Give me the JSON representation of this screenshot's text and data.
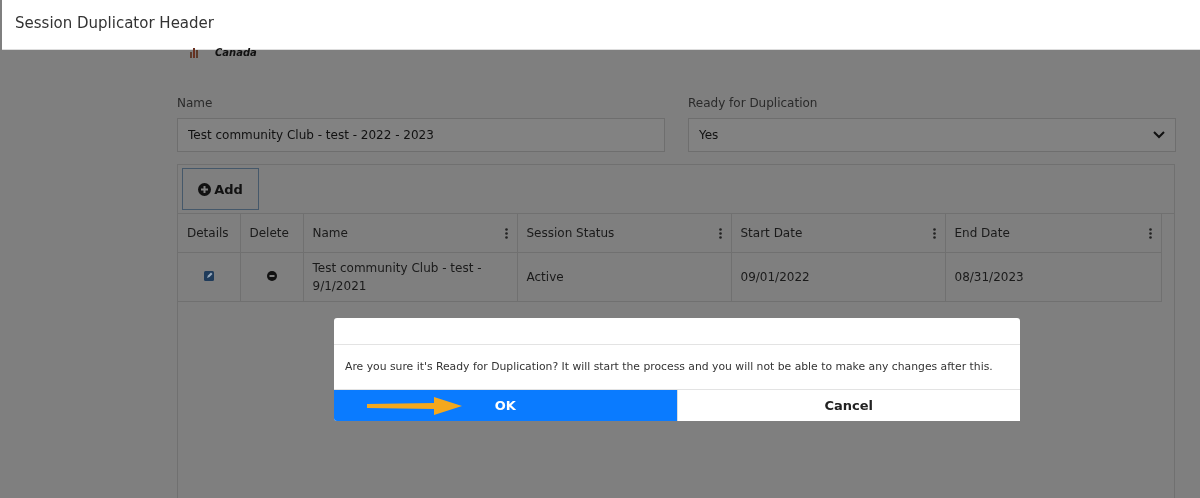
{
  "header": {
    "title": "Session Duplicator Header"
  },
  "logo": {
    "text": "Canada"
  },
  "form": {
    "fields": [
      {
        "label": "Name",
        "kind": "text",
        "value": "Test community Club - test - 2022 - 2023"
      },
      {
        "label": "Ready for Duplication",
        "kind": "select",
        "value": "Yes"
      }
    ]
  },
  "grid": {
    "add_button": "Add",
    "columns": [
      {
        "label": "Details",
        "has_menu": false
      },
      {
        "label": "Delete",
        "has_menu": false
      },
      {
        "label": "Name",
        "has_menu": true
      },
      {
        "label": "Session Status",
        "has_menu": true
      },
      {
        "label": "Start Date",
        "has_menu": true
      },
      {
        "label": "End Date",
        "has_menu": true
      }
    ],
    "rows": [
      {
        "name": "Test community Club - test - 9/1/2021",
        "status": "Active",
        "start": "09/01/2022",
        "end": "08/31/2023"
      }
    ]
  },
  "dialog": {
    "message": "Are you sure it's Ready for Duplication? It will start the process and you will not be able to make any changes after this.",
    "buttons": [
      {
        "label": "OK",
        "kind": "primary"
      },
      {
        "label": "Cancel",
        "kind": "secondary"
      }
    ]
  }
}
